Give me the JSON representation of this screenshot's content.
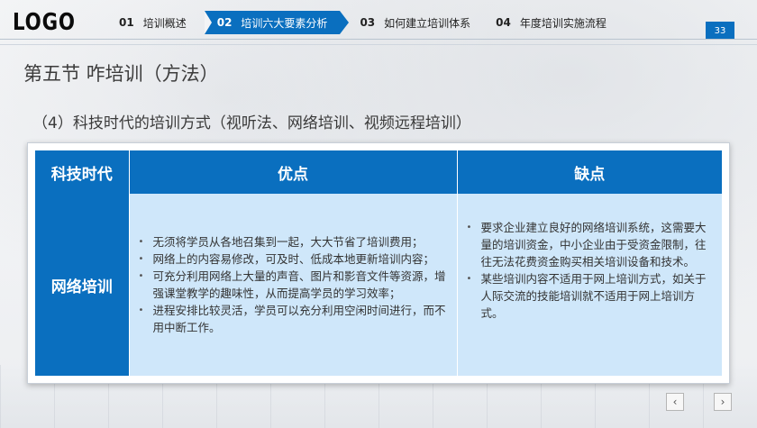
{
  "header": {
    "logo": "LOGO",
    "nav": [
      {
        "num": "01",
        "label": "培训概述",
        "active": false
      },
      {
        "num": "02",
        "label": "培训六大要素分析",
        "active": true
      },
      {
        "num": "03",
        "label": "如何建立培训体系",
        "active": false
      },
      {
        "num": "04",
        "label": "年度培训实施流程",
        "active": false
      }
    ],
    "page_number": "33"
  },
  "section_title": "第五节  咋培训（方法）",
  "subtitle": "（4）科技时代的培训方式（视听法、网络培训、视频远程培训）",
  "table": {
    "headers": [
      "科技时代",
      "优点",
      "缺点"
    ],
    "row_label": "网络培训",
    "pros": [
      "无须将学员从各地召集到一起，大大节省了培训费用；",
      "网络上的内容易修改，可及时、低成本地更新培训内容；",
      "可充分利用网络上大量的声音、图片和影音文件等资源，增强课堂教学的趣味性，从而提高学员的学习效率；",
      "进程安排比较灵活，学员可以充分利用空闲时间进行，而不用中断工作。"
    ],
    "cons": [
      "要求企业建立良好的网络培训系统，这需要大量的培训资金，中小企业由于受资金限制，往往无法花费资金购买相关培训设备和技术。",
      "某些培训内容不适用于网上培训方式，如关于人际交流的技能培训就不适用于网上培训方式。"
    ]
  },
  "pager": {
    "prev": "‹",
    "next": "›"
  },
  "colors": {
    "accent": "#0a6fbf",
    "cell_bg": "#cfe7fa"
  }
}
